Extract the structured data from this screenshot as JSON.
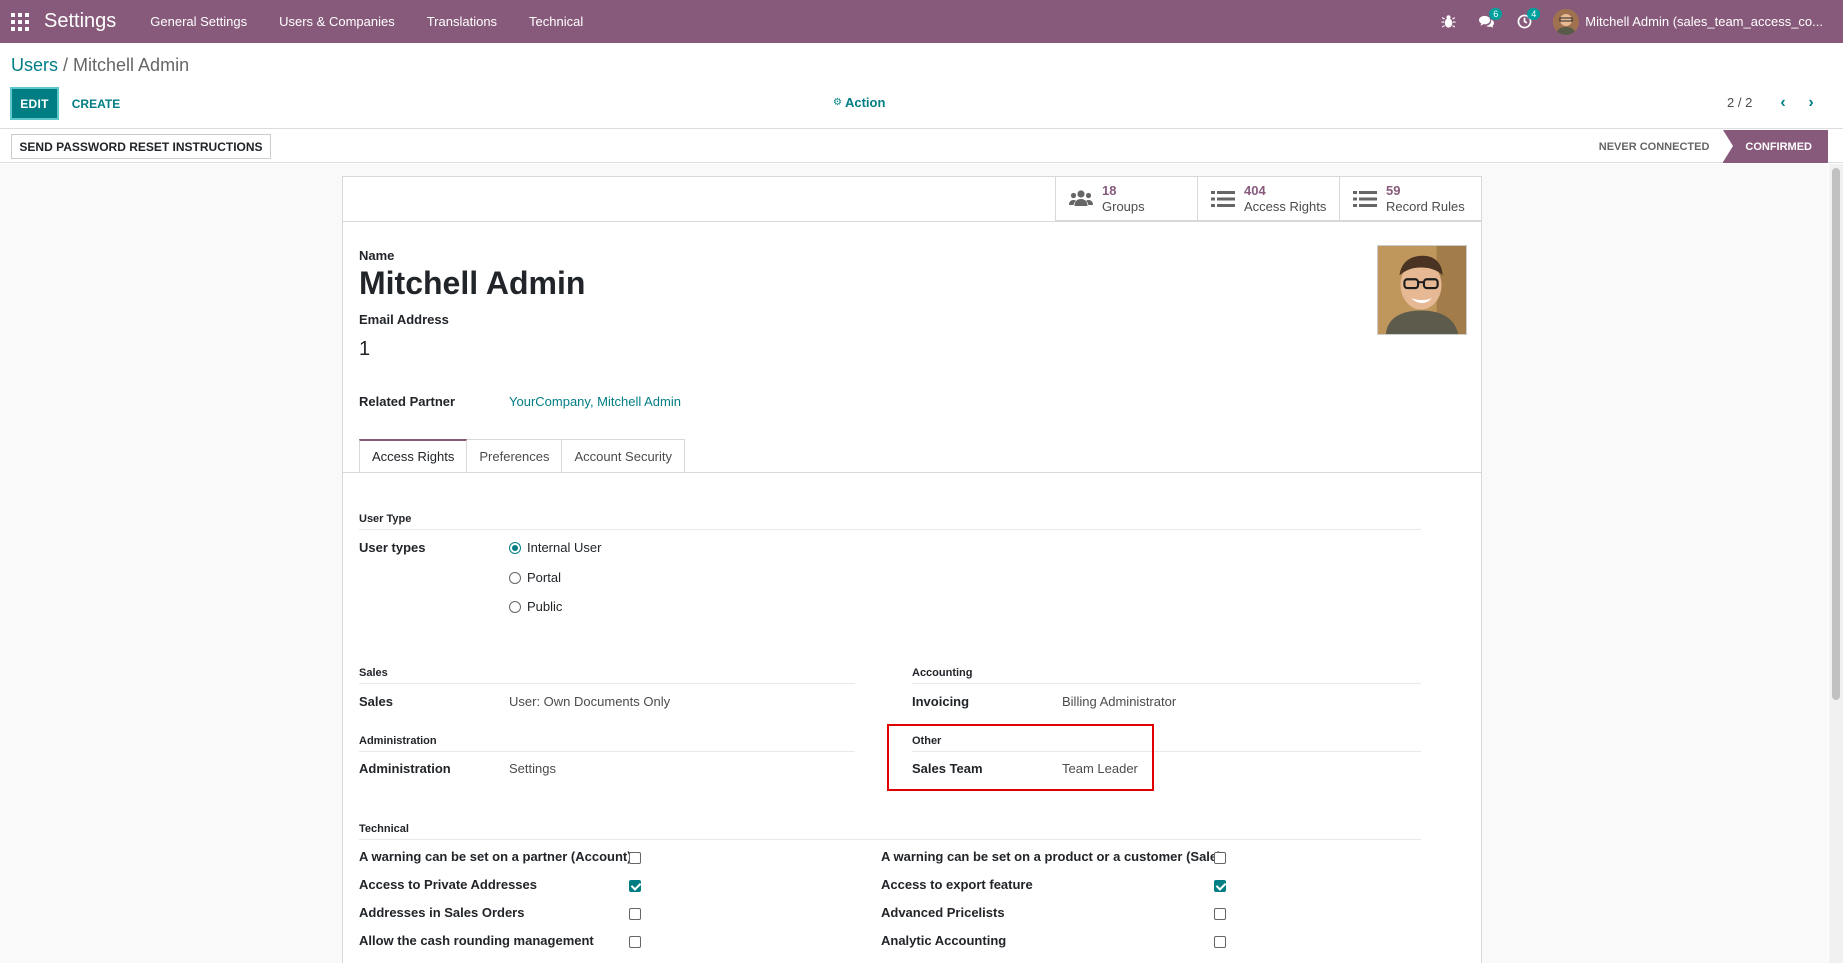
{
  "navbar": {
    "app_title": "Settings",
    "menu": [
      "General Settings",
      "Users & Companies",
      "Translations",
      "Technical"
    ],
    "messages_badge": "6",
    "activities_badge": "4",
    "user": "Mitchell Admin (sales_team_access_co..."
  },
  "control_panel": {
    "breadcrumb_parent": "Users",
    "breadcrumb_sep": " / ",
    "breadcrumb_current": "Mitchell Admin",
    "edit_label": "EDIT",
    "create_label": "CREATE",
    "action_label": "Action",
    "pager": "2 / 2"
  },
  "statusbar": {
    "reset_button": "SEND PASSWORD RESET INSTRUCTIONS",
    "steps": [
      "NEVER CONNECTED",
      "CONFIRMED"
    ],
    "active_step": "CONFIRMED"
  },
  "stat_buttons": [
    {
      "value": "18",
      "label": "Groups",
      "icon": "users-icon"
    },
    {
      "value": "404",
      "label": "Access Rights",
      "icon": "list-icon"
    },
    {
      "value": "59",
      "label": "Record Rules",
      "icon": "list-icon"
    }
  ],
  "form": {
    "name_label": "Name",
    "name_value": "Mitchell Admin",
    "email_label": "Email Address",
    "email_value": "1",
    "partner_label": "Related Partner",
    "partner_value": "YourCompany, Mitchell Admin"
  },
  "tabs": [
    "Access Rights",
    "Preferences",
    "Account Security"
  ],
  "access_rights": {
    "user_type_section": "User Type",
    "user_types_label": "User types",
    "user_types": [
      "Internal User",
      "Portal",
      "Public"
    ],
    "selected_user_type": "Internal User",
    "sales_section": "Sales",
    "sales_label": "Sales",
    "sales_value": "User: Own Documents Only",
    "accounting_section": "Accounting",
    "invoicing_label": "Invoicing",
    "invoicing_value": "Billing Administrator",
    "administration_section": "Administration",
    "administration_label": "Administration",
    "administration_value": "Settings",
    "other_section": "Other",
    "sales_team_label": "Sales Team",
    "sales_team_value": "Team Leader",
    "technical_section": "Technical",
    "technical_left": [
      {
        "label": "A warning can be set on a partner (Account)",
        "checked": false
      },
      {
        "label": "Access to Private Addresses",
        "checked": true
      },
      {
        "label": "Addresses in Sales Orders",
        "checked": false
      },
      {
        "label": "Allow the cash rounding management",
        "checked": false
      }
    ],
    "technical_right": [
      {
        "label": "A warning can be set on a product or a customer (Sale)",
        "checked": false
      },
      {
        "label": "Access to export feature",
        "checked": true
      },
      {
        "label": "Advanced Pricelists",
        "checked": false
      },
      {
        "label": "Analytic Accounting",
        "checked": false
      }
    ]
  },
  "colors": {
    "brand": "#875a7b",
    "primary": "#017e84",
    "highlight": "#e00000"
  }
}
